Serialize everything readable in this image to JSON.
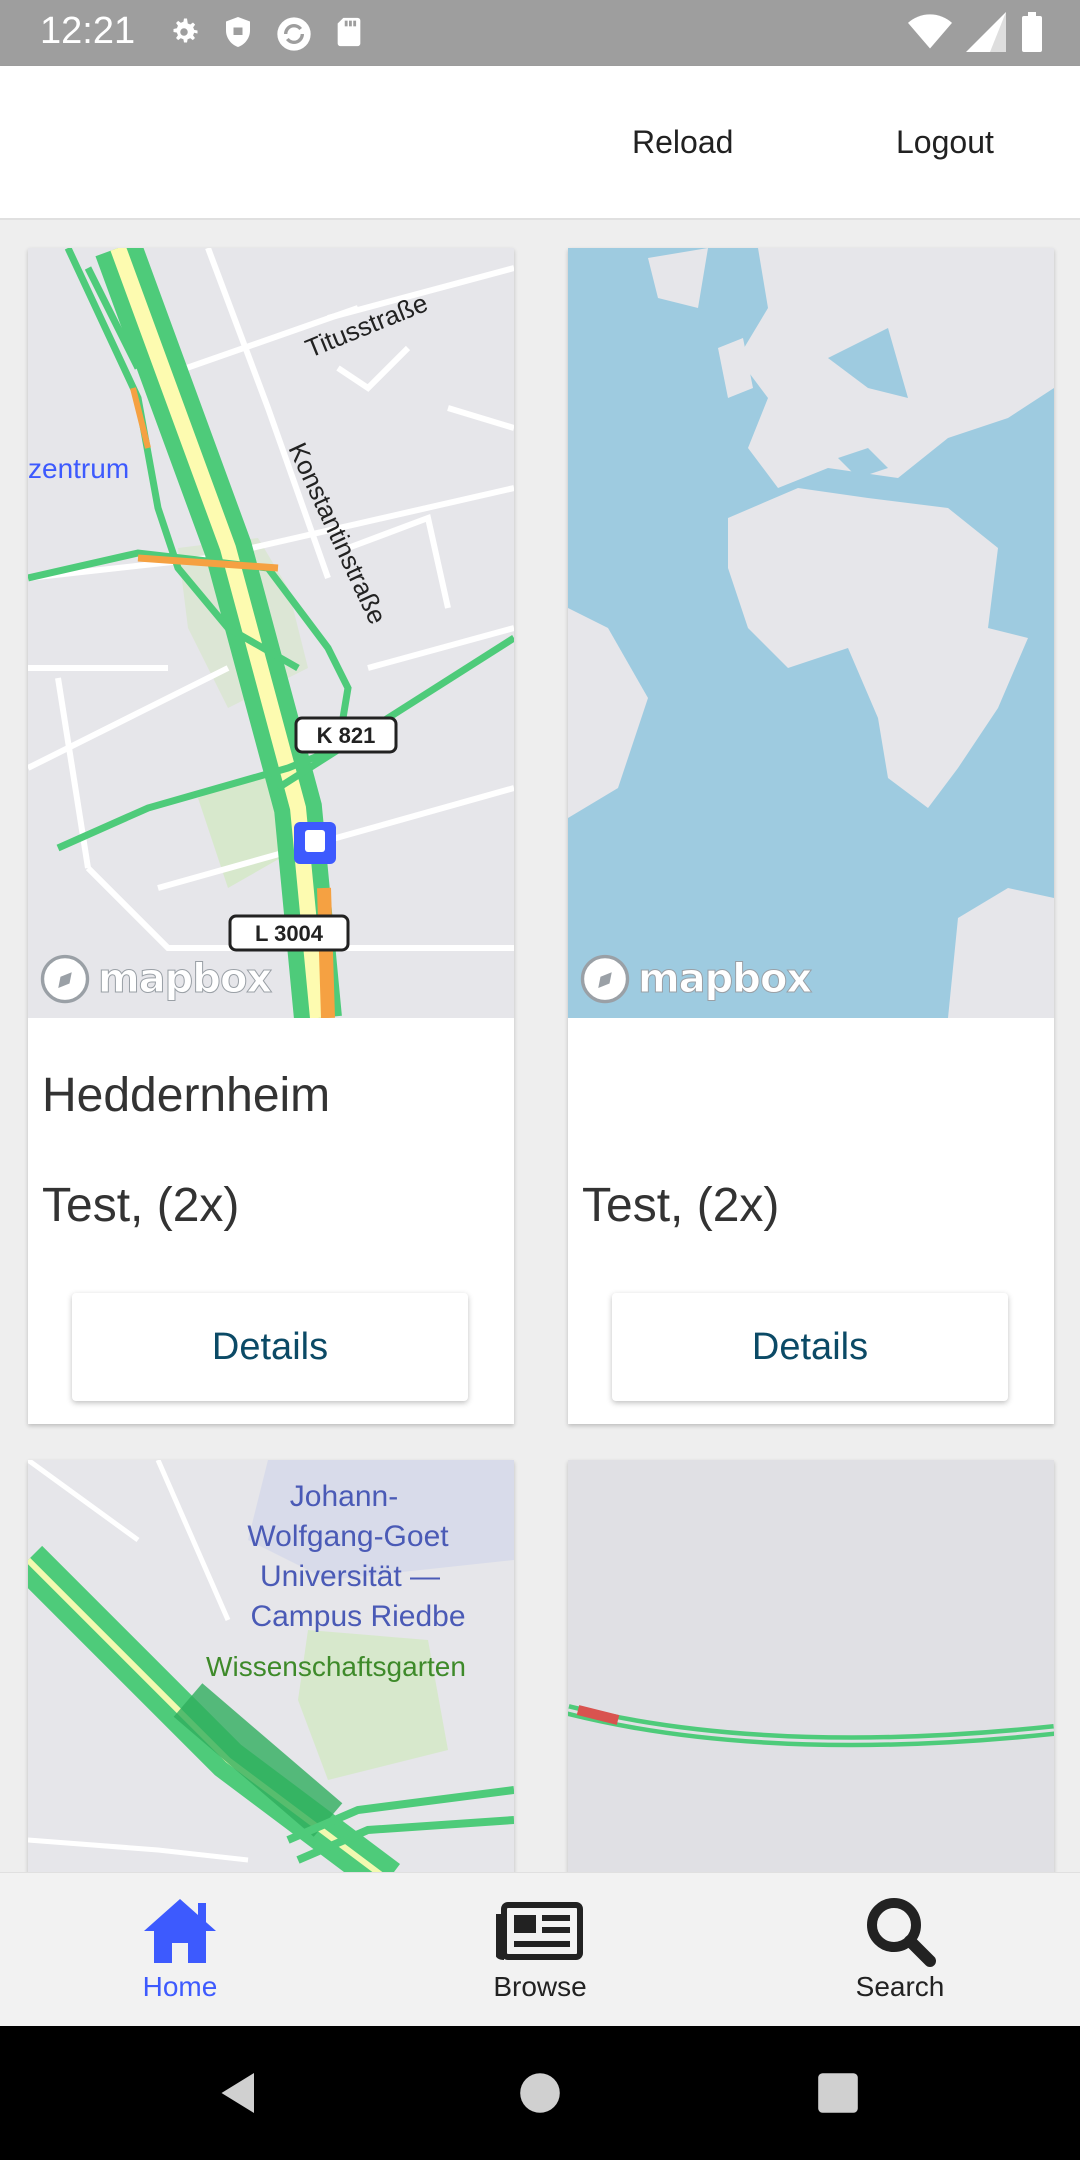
{
  "status_bar": {
    "time": "12:21",
    "left_icons": [
      "gear-icon",
      "shield-icon",
      "sync-icon",
      "sd-card-icon"
    ],
    "right_icons": [
      "wifi-icon",
      "signal-icon",
      "battery-icon"
    ]
  },
  "header": {
    "reload_label": "Reload",
    "logout_label": "Logout"
  },
  "cards": [
    {
      "title": "Heddernheim",
      "subtitle": "Test, (2x)",
      "details_label": "Details",
      "map": {
        "type": "street",
        "labels": [
          "Titusstraße",
          "Konstantinstraße",
          "zentrum",
          "K 821",
          "L 3004"
        ],
        "attribution": "mapbox"
      }
    },
    {
      "title": "",
      "subtitle": "Test, (2x)",
      "details_label": "Details",
      "map": {
        "type": "world",
        "attribution": "mapbox"
      }
    },
    {
      "map": {
        "type": "street",
        "labels": [
          "Johann-",
          "Wolfgang-Goet",
          "Universität —",
          "Campus Riedbe",
          "Wissenschaftsgarten"
        ]
      }
    },
    {
      "map": {
        "type": "street"
      }
    }
  ],
  "bottom_nav": {
    "items": [
      {
        "label": "Home",
        "icon": "home-icon",
        "active": true
      },
      {
        "label": "Browse",
        "icon": "newspaper-icon",
        "active": false
      },
      {
        "label": "Search",
        "icon": "search-icon",
        "active": false
      }
    ]
  },
  "colors": {
    "active_nav": "#3d5afe",
    "details_text": "#0b4a66",
    "road_green": "#4ecb7a",
    "road_orange": "#f5a142",
    "water": "#9ecbe0",
    "land": "#e6e6ea"
  }
}
